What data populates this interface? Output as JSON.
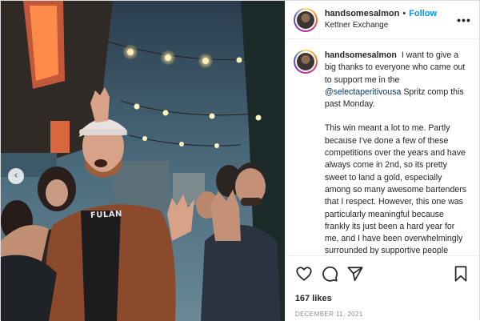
{
  "post": {
    "username": "handsomesalmon",
    "separator": "•",
    "follow_label": "Follow",
    "location": "Kettner Exchange",
    "more_icon": "more-icon",
    "shirt_text": "FULAN"
  },
  "caption": {
    "username": "handsomesalmon",
    "text_before": "I want to give a big thanks to everyone who came out to support me in the ",
    "mention": "@selectaperitivousa",
    "text_after": " Spritz comp this past Monday.",
    "paragraph_2": "This win meant a lot to me. Partly because I've done a few of these competitions over the years and have always come in 2nd, so its pretty sweet to land a gold, especially among so many awesome bartenders that I respect. However, this one was particularly meaningful because frankly its just been a hard year for me, and I have been overwhelmingly surrounded by supportive people since moving to San Diego. For me, this moment signifies growth, it affirms that I have landed in the right"
  },
  "actions": {
    "icons": [
      "heart-icon",
      "comment-icon",
      "share-icon",
      "bookmark-icon"
    ],
    "likes": "167 likes",
    "date": "DECEMBER 11, 2021"
  },
  "colors": {
    "link_blue": "#0095f6",
    "mention_blue": "#00376b",
    "muted_gray": "#8e8e8e"
  }
}
